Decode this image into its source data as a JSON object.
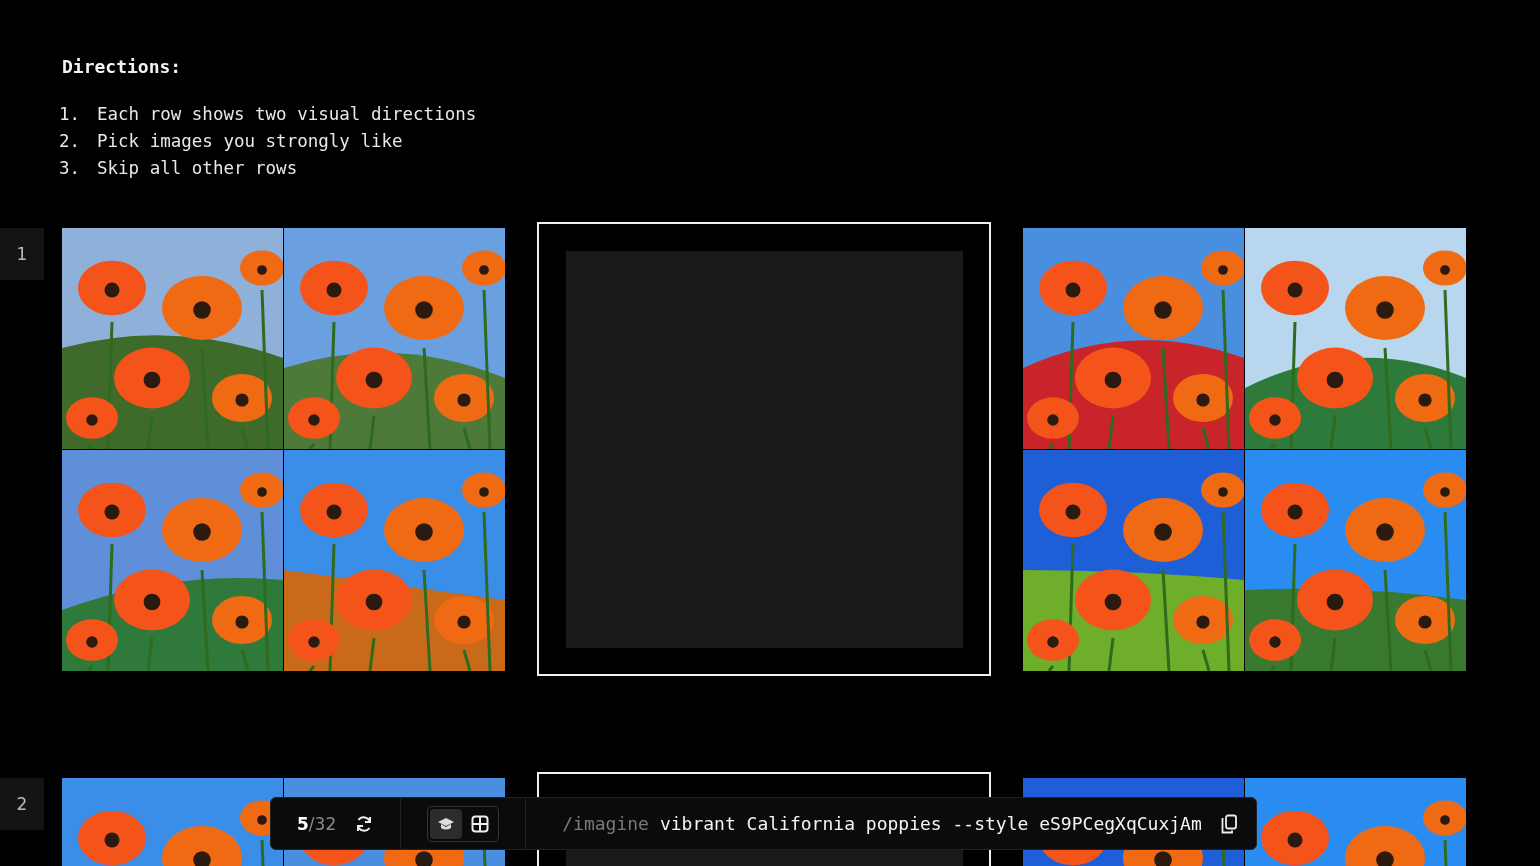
{
  "directions": {
    "title": "Directions:",
    "steps": [
      {
        "number": "1.",
        "text": "Each row shows two visual directions"
      },
      {
        "number": "2.",
        "text": "Pick images you strongly like"
      },
      {
        "number": "3.",
        "text": "Skip all other rows"
      }
    ]
  },
  "rows": [
    {
      "number": "1"
    },
    {
      "number": "2"
    }
  ],
  "toolbar": {
    "current": "5",
    "total": "/32",
    "modes": [
      {
        "kind": "learn",
        "selected": true
      },
      {
        "kind": "grid",
        "selected": false
      }
    ],
    "command": "/imagine",
    "prompt": "vibrant California poppies --style eS9PCegXqCuxjAm"
  }
}
